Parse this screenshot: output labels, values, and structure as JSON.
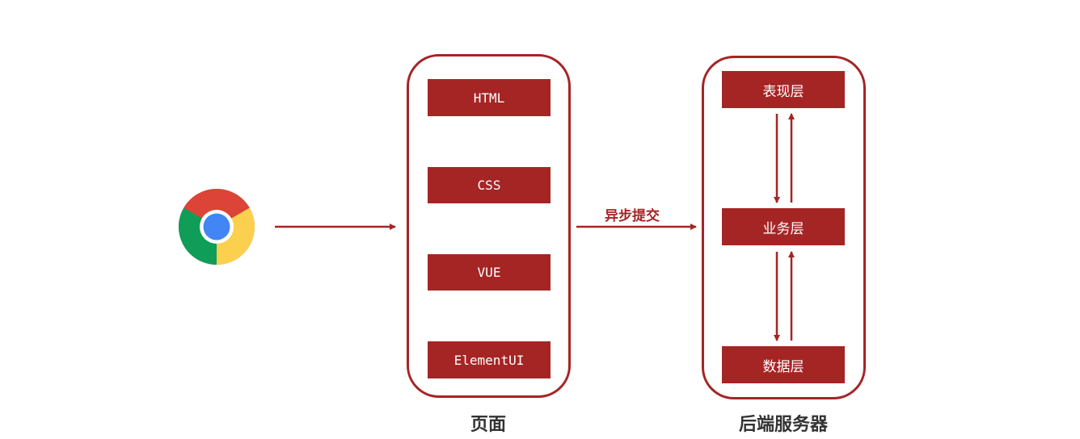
{
  "browser": {
    "icon": "chrome-icon"
  },
  "frontend": {
    "title": "页面",
    "items": [
      "HTML",
      "CSS",
      "VUE",
      "ElementUI"
    ]
  },
  "connection": {
    "label": "异步提交"
  },
  "backend": {
    "title": "后端服务器",
    "layers": [
      "表现层",
      "业务层",
      "数据层"
    ]
  },
  "colors": {
    "accent": "#a52525",
    "caption": "#333333"
  }
}
